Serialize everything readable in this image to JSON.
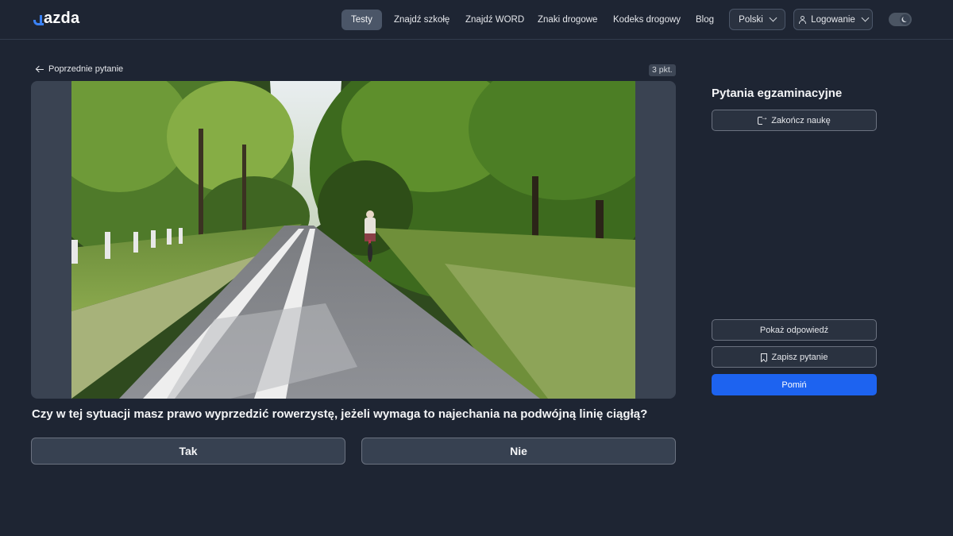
{
  "header": {
    "logo": "azda",
    "nav": [
      {
        "label": "Testy",
        "active": true
      },
      {
        "label": "Znajdź szkołę",
        "active": false
      },
      {
        "label": "Znajdź WORD",
        "active": false
      },
      {
        "label": "Znaki drogowe",
        "active": false
      },
      {
        "label": "Kodeks drogowy",
        "active": false
      },
      {
        "label": "Blog",
        "active": false
      }
    ],
    "language": "Polski",
    "login": "Logowanie",
    "theme_toggle_icon": "moon-icon"
  },
  "question": {
    "back_label": "Poprzednie pytanie",
    "points": "3 pkt.",
    "text": "Czy w tej sytuacji masz prawo wyprzedzić rowerzystę, jeżeli wymaga to najechania na podwójną linię ciągłą?",
    "answers": [
      "Tak",
      "Nie"
    ]
  },
  "sidebar": {
    "title": "Pytania egzaminacyjne",
    "finish_label": "Zakończ naukę",
    "show_answer_label": "Pokaż odpowiedź",
    "save_label": "Zapisz pytanie",
    "skip_label": "Pomiń"
  },
  "colors": {
    "background": "#1e2533",
    "primary": "#1d63f0",
    "accent_logo": "#3b82f6"
  }
}
